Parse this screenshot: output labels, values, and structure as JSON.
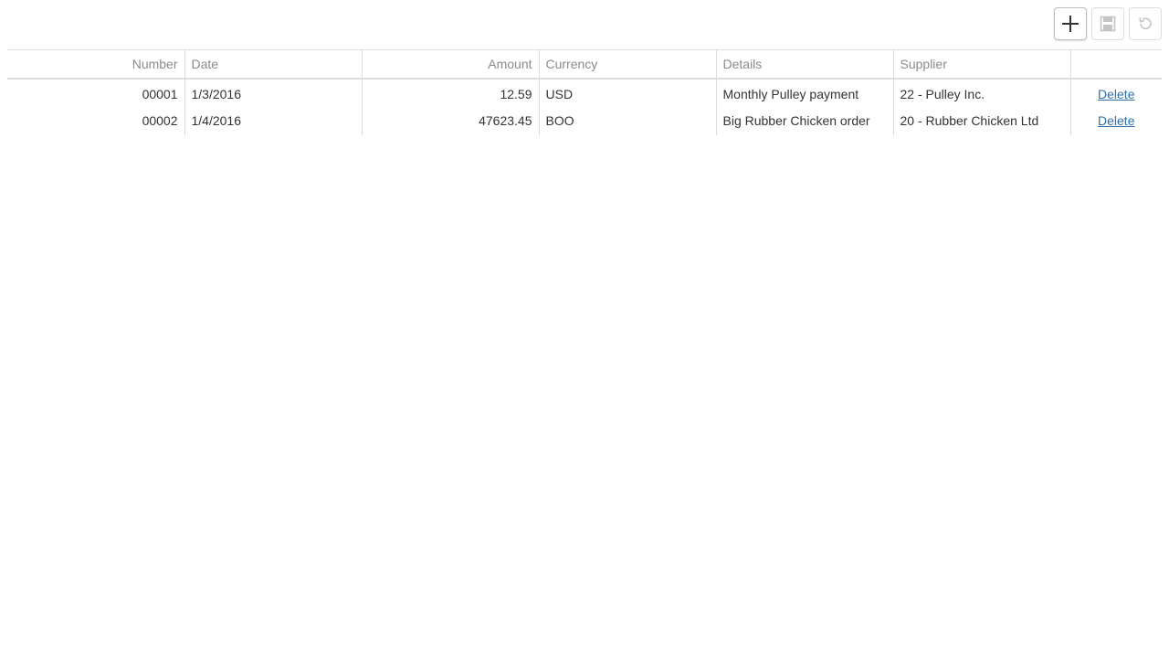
{
  "toolbar": {
    "add_icon": "plus-icon",
    "save_icon": "save-icon",
    "cancel_icon": "undo-icon"
  },
  "grid": {
    "columns": [
      "Number",
      "Date",
      "Amount",
      "Currency",
      "Details",
      "Supplier",
      ""
    ],
    "rows": [
      {
        "number": "00001",
        "date": "1/3/2016",
        "amount": "12.59",
        "currency": "USD",
        "details": "Monthly Pulley payment",
        "supplier": "22 - Pulley Inc.",
        "action": "Delete"
      },
      {
        "number": "00002",
        "date": "1/4/2016",
        "amount": "47623.45",
        "currency": "BOO",
        "details": "Big Rubber Chicken order",
        "supplier": "20 - Rubber Chicken Ltd",
        "action": "Delete"
      }
    ]
  },
  "colors": {
    "link": "#2f6fa8",
    "header_text": "#8a8a8a",
    "border": "#dcdcdc"
  }
}
